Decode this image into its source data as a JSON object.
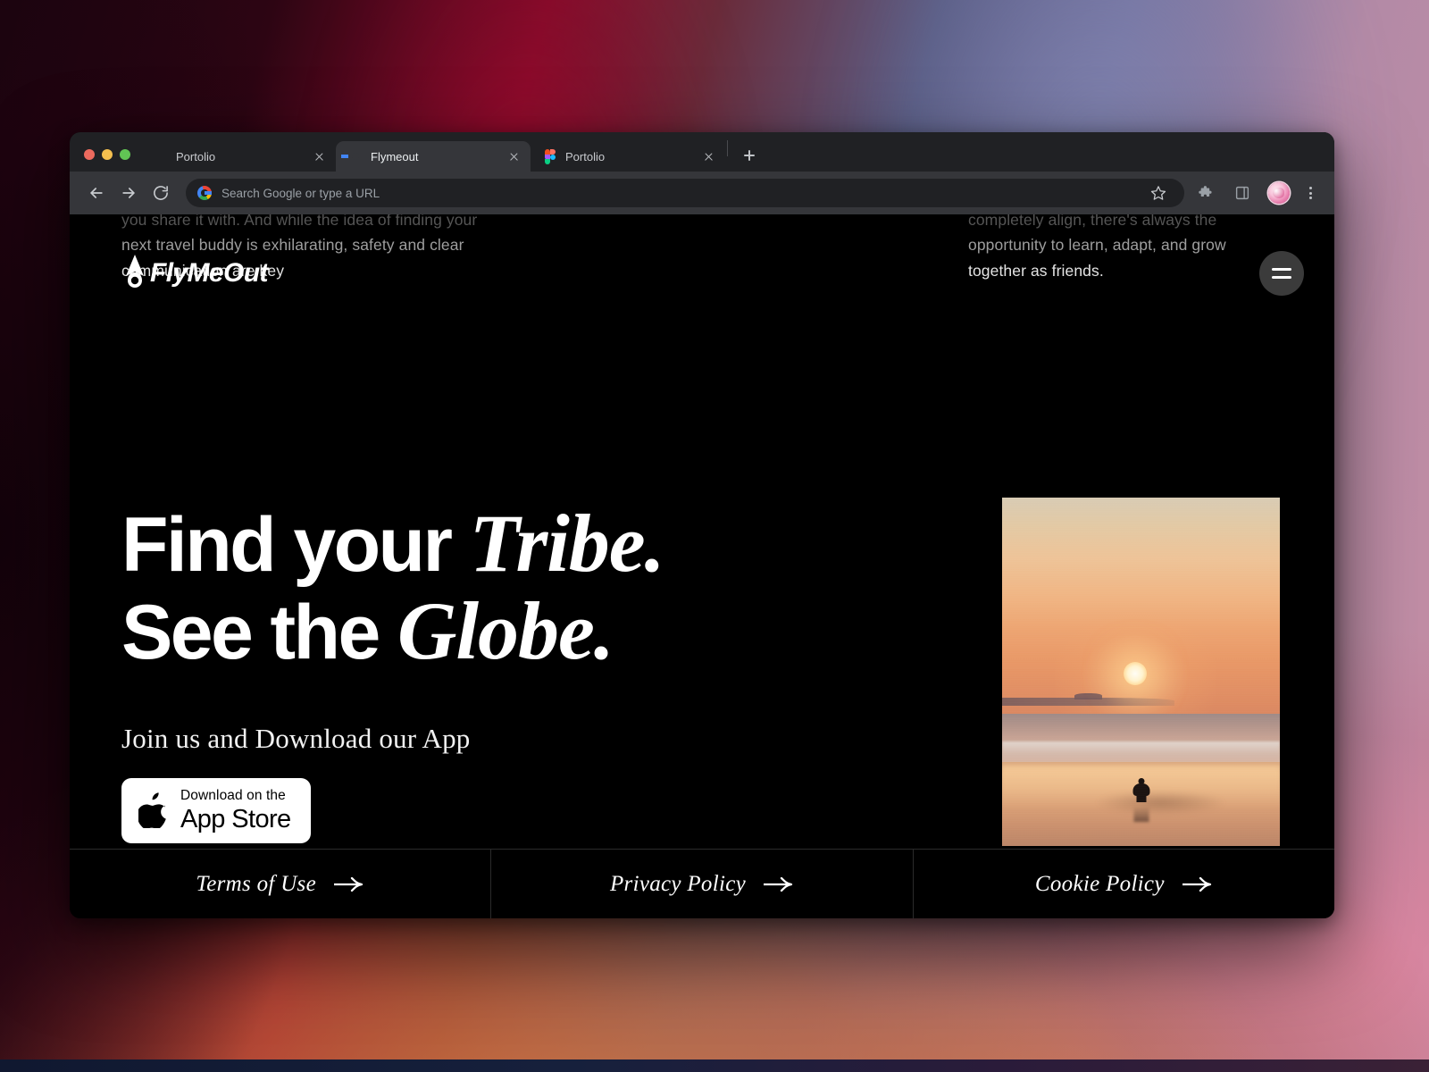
{
  "browser": {
    "traffic_lights": [
      "close",
      "minimize",
      "maximize"
    ],
    "tabs": [
      {
        "title": "Portolio",
        "favicon": "dribbble-pink-circle-icon",
        "active": false
      },
      {
        "title": "Flymeout",
        "favicon": "google-icon",
        "active": true
      },
      {
        "title": "Portolio",
        "favicon": "figma-icon",
        "active": false
      }
    ],
    "new_tab_label": "+",
    "nav": {
      "back": "back-arrow-icon",
      "forward": "forward-arrow-icon",
      "reload": "reload-icon"
    },
    "omnibox": {
      "placeholder": "Search Google or type a URL",
      "value": "",
      "leading_icon": "google-icon",
      "bookmark_icon": "star-icon"
    },
    "toolbar_icons": [
      "extensions-puzzle-icon",
      "side-panel-icon",
      "profile-avatar",
      "more-menu-icon"
    ]
  },
  "site": {
    "brand": {
      "name": "FlyMeOut",
      "mark": "paper-plane-icon"
    },
    "menu_button": "hamburger-menu-icon",
    "ghost_text_left": {
      "line1": "you share it with. And while the idea of finding your",
      "line2": "next travel buddy is exhilarating, safety and clear",
      "line3": "communication are key"
    },
    "ghost_text_right": {
      "line1": "completely align, there's always the",
      "line2": "opportunity to learn, adapt, and grow",
      "line3": "together as friends."
    },
    "hero": {
      "headline_line1_sans": "Find your",
      "headline_line1_serif": "Tribe.",
      "headline_line2_sans": "See the",
      "headline_line2_serif": "Globe.",
      "subtitle": "Join us and Download our App",
      "app_store": {
        "small_label": "Download on the",
        "big_label": "App Store",
        "icon": "apple-logo-icon"
      },
      "photo_alt": "beach-sunset-photo"
    },
    "footer": {
      "links": [
        {
          "label": "Terms of Use",
          "icon": "arrow-right-icon"
        },
        {
          "label": "Privacy Policy",
          "icon": "arrow-right-icon"
        },
        {
          "label": "Cookie Policy",
          "icon": "arrow-right-icon"
        }
      ]
    }
  },
  "colors": {
    "page_background": "#000000",
    "browser_tabstrip": "#202124",
    "browser_toolbar": "#35363a",
    "omnibox": "#202124",
    "accent_pink": "#ee3d7f",
    "menu_button": "#3b3b3b",
    "footer_divider": "#2b2b2b",
    "app_store_button": "#ffffff"
  }
}
